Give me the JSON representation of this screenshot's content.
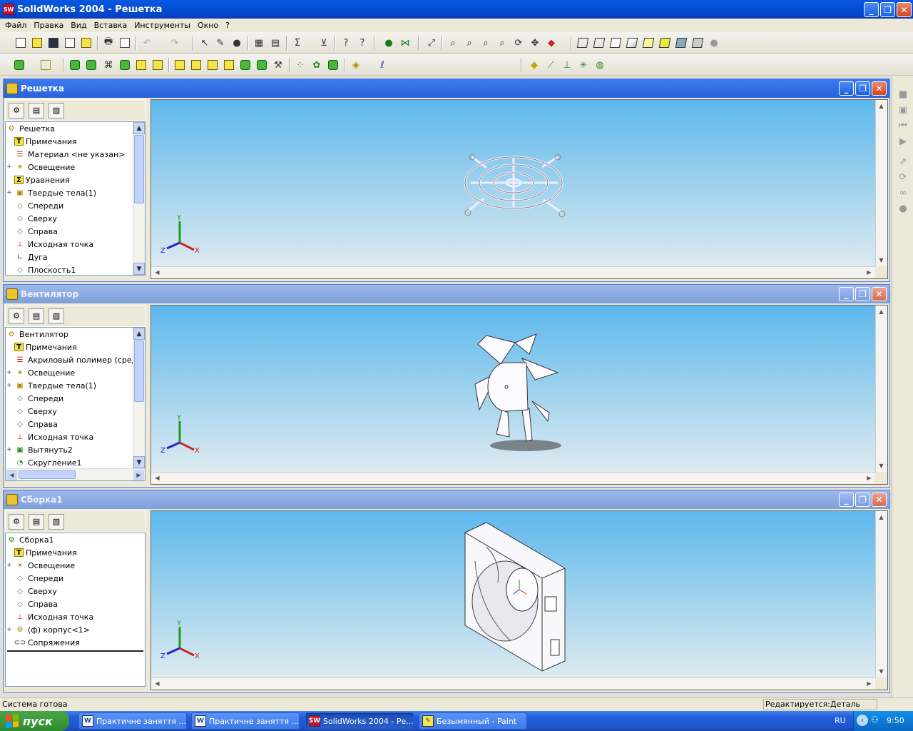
{
  "app": {
    "title": "SolidWorks 2004 - Решетка",
    "icon_label": "SW"
  },
  "menu": [
    "Файл",
    "Правка",
    "Вид",
    "Вставка",
    "Инструменты",
    "Окно",
    "?"
  ],
  "windows": [
    {
      "title": "Решетка",
      "active": true,
      "tree": [
        {
          "label": "Решетка",
          "icon": "part-icon",
          "expand": ""
        },
        {
          "label": "Примечания",
          "icon": "annotations-icon",
          "expand": ""
        },
        {
          "label": "Материал <не указан>",
          "icon": "material-icon",
          "expand": ""
        },
        {
          "label": "Освещение",
          "icon": "lighting-icon",
          "expand": "+"
        },
        {
          "label": "Уравнения",
          "icon": "equations-icon",
          "expand": ""
        },
        {
          "label": "Твердые тела(1)",
          "icon": "solid-bodies-icon",
          "expand": "+"
        },
        {
          "label": "Спереди",
          "icon": "plane-icon",
          "expand": ""
        },
        {
          "label": "Сверху",
          "icon": "plane-icon",
          "expand": ""
        },
        {
          "label": "Справа",
          "icon": "plane-icon",
          "expand": ""
        },
        {
          "label": "Исходная точка",
          "icon": "origin-icon",
          "expand": ""
        },
        {
          "label": "Дуга",
          "icon": "sketch-icon",
          "expand": ""
        },
        {
          "label": "Плоскость1",
          "icon": "plane-icon",
          "expand": ""
        }
      ]
    },
    {
      "title": "Вентилятор",
      "active": false,
      "tree": [
        {
          "label": "Вентилятор",
          "icon": "part-icon",
          "expand": ""
        },
        {
          "label": "Примечания",
          "icon": "annotations-icon",
          "expand": ""
        },
        {
          "label": "Акриловый полимер (сред",
          "icon": "material-icon",
          "expand": ""
        },
        {
          "label": "Освещение",
          "icon": "lighting-icon",
          "expand": "+"
        },
        {
          "label": "Твердые тела(1)",
          "icon": "solid-bodies-icon",
          "expand": "+"
        },
        {
          "label": "Спереди",
          "icon": "plane-icon",
          "expand": ""
        },
        {
          "label": "Сверху",
          "icon": "plane-icon",
          "expand": ""
        },
        {
          "label": "Справа",
          "icon": "plane-icon",
          "expand": ""
        },
        {
          "label": "Исходная точка",
          "icon": "origin-icon",
          "expand": ""
        },
        {
          "label": "Вытянуть2",
          "icon": "extrude-icon",
          "expand": "+"
        },
        {
          "label": "Скругление1",
          "icon": "fillet-icon",
          "expand": ""
        }
      ]
    },
    {
      "title": "Сборка1",
      "active": false,
      "tree": [
        {
          "label": "Сборка1",
          "icon": "assembly-icon",
          "expand": ""
        },
        {
          "label": "Примечания",
          "icon": "annotations-icon",
          "expand": ""
        },
        {
          "label": "Освещение",
          "icon": "lighting-icon",
          "expand": "+"
        },
        {
          "label": "Спереди",
          "icon": "plane-icon",
          "expand": ""
        },
        {
          "label": "Сверху",
          "icon": "plane-icon",
          "expand": ""
        },
        {
          "label": "Справа",
          "icon": "plane-icon",
          "expand": ""
        },
        {
          "label": "Исходная точка",
          "icon": "origin-icon",
          "expand": ""
        },
        {
          "label": "(ф) корпус<1>",
          "icon": "component-icon",
          "expand": "+"
        },
        {
          "label": "Сопряжения",
          "icon": "mates-icon",
          "expand": ""
        }
      ]
    }
  ],
  "triad": {
    "x": "X",
    "y": "Y",
    "z": "Z"
  },
  "status": {
    "left": "Система готова",
    "right": "Редактируется:Деталь"
  },
  "taskbar": {
    "start": "пуск",
    "buttons": [
      {
        "label": "Практичне заняття ...",
        "icon": "word-icon",
        "active": false
      },
      {
        "label": "Практичне заняття ...",
        "icon": "word-icon",
        "active": false
      },
      {
        "label": "SolidWorks 2004 - Ре...",
        "icon": "solidworks-icon",
        "active": true
      },
      {
        "label": "Безымянный - Paint",
        "icon": "paint-icon",
        "active": false
      }
    ],
    "lang": "RU",
    "clock": "9:50"
  },
  "colors": {
    "viewport_top": "#5db8ee",
    "viewport_bottom": "#e6eef2",
    "title_active": "#2a62d8",
    "title_inactive": "#7e9fd8",
    "taskbar": "#245edb",
    "start": "#3c9a3c"
  }
}
